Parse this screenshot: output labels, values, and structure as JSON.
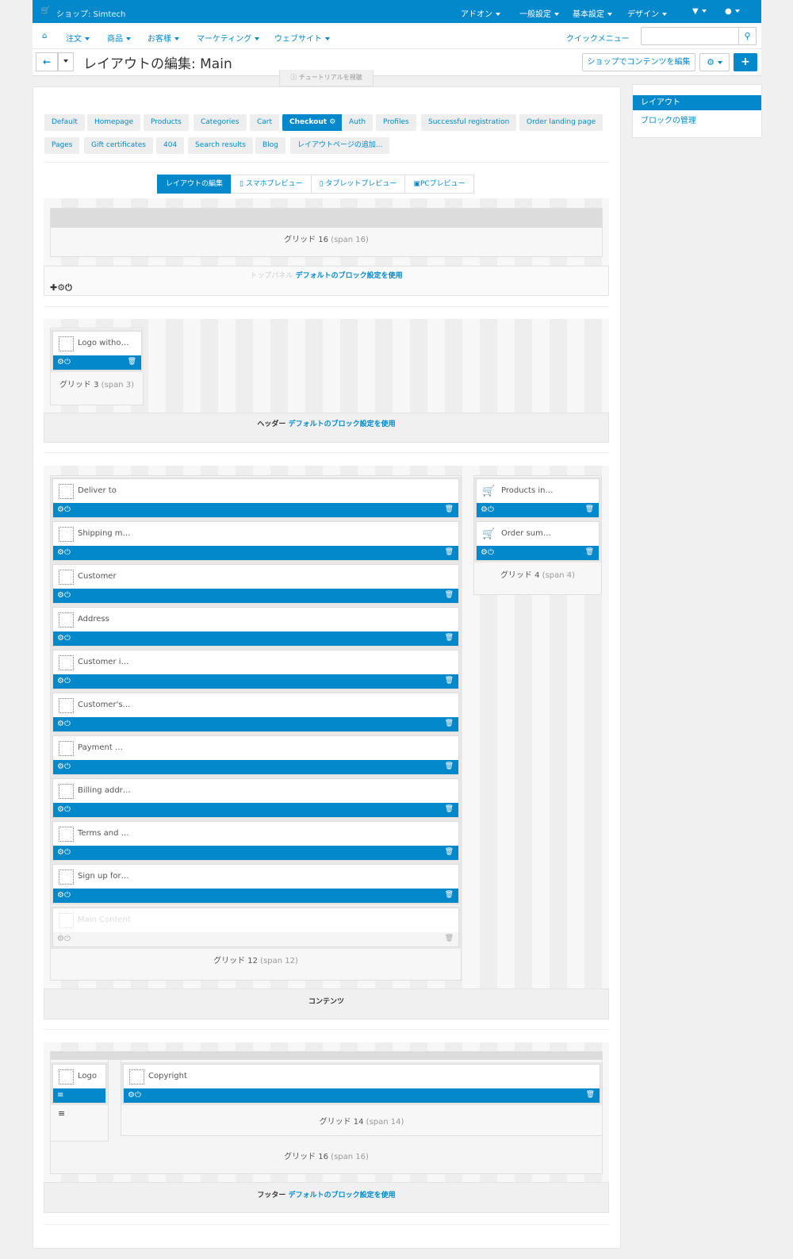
{
  "topbar": {
    "shop_name": "ショップ: Simtech",
    "menus": [
      "アドオン",
      "一般設定",
      "基本設定",
      "デザイン"
    ],
    "bell_icon": "bell-icon",
    "user_icon": "user-icon"
  },
  "subnav": {
    "items": [
      "注文",
      "商品",
      "お客様",
      "マーケティング",
      "ウェブサイト"
    ],
    "quick_menu": "クイックメニュー",
    "search_placeholder": ""
  },
  "titlebar": {
    "title": "レイアウトの編集: Main",
    "edit_content_button": "ショップでコンテンツを編集",
    "tutorial": "チュートリアルを視聴"
  },
  "layout_tabs": {
    "row1": [
      "Default",
      "Homepage",
      "Products",
      "Categories",
      "Cart",
      "Checkout",
      "Auth",
      "Profiles",
      "Successful registration",
      "Order landing page"
    ],
    "row2": [
      "Pages",
      "Gift certificates",
      "404",
      "Search results",
      "Blog",
      "レイアウトページの追加..."
    ],
    "active": "Checkout"
  },
  "view_tabs": [
    "レイアウトの編集",
    "スマホプレビュー",
    "タブレットプレビュー",
    "PCプレビュー"
  ],
  "top_panel": {
    "grid_label": "グリッド 16",
    "grid_span": "(span 16)",
    "footer_name": "トップパネル",
    "footer_link": "デフォルトのブロック設定を使用"
  },
  "header": {
    "block_name": "Logo witho…",
    "grid_label": "グリッド 3",
    "grid_span": "(span 3)",
    "footer_name": "ヘッダー",
    "footer_link": "デフォルトのブロック設定を使用"
  },
  "content": {
    "blocks": [
      "Deliver to",
      "Shipping m…",
      "Customer",
      "Address",
      "Customer i…",
      "Customer's…",
      "Payment …",
      "Billing addr…",
      "Terms and …",
      "Sign up for…"
    ],
    "disabled_block": "Main Content",
    "grid_label": "グリッド 12",
    "grid_span": "(span 12)",
    "side_blocks": [
      "Products in…",
      "Order sum…"
    ],
    "side_grid_label": "グリッド 4",
    "side_grid_span": "(span 4)",
    "footer_name": "コンテンツ"
  },
  "footer": {
    "logo_block": "Logo",
    "copyright_block": "Copyright",
    "inner_grid_label": "グリッド 14",
    "inner_grid_span": "(span 14)",
    "grid_label": "グリッド 16",
    "grid_span": "(span 16)",
    "footer_name": "フッター",
    "footer_link": "デフォルトのブロック設定を使用"
  },
  "sidebar": {
    "active": "レイアウト",
    "link": "ブロックの管理"
  },
  "colors": {
    "accent": "#0388cc",
    "background": "#f0f0f0"
  }
}
